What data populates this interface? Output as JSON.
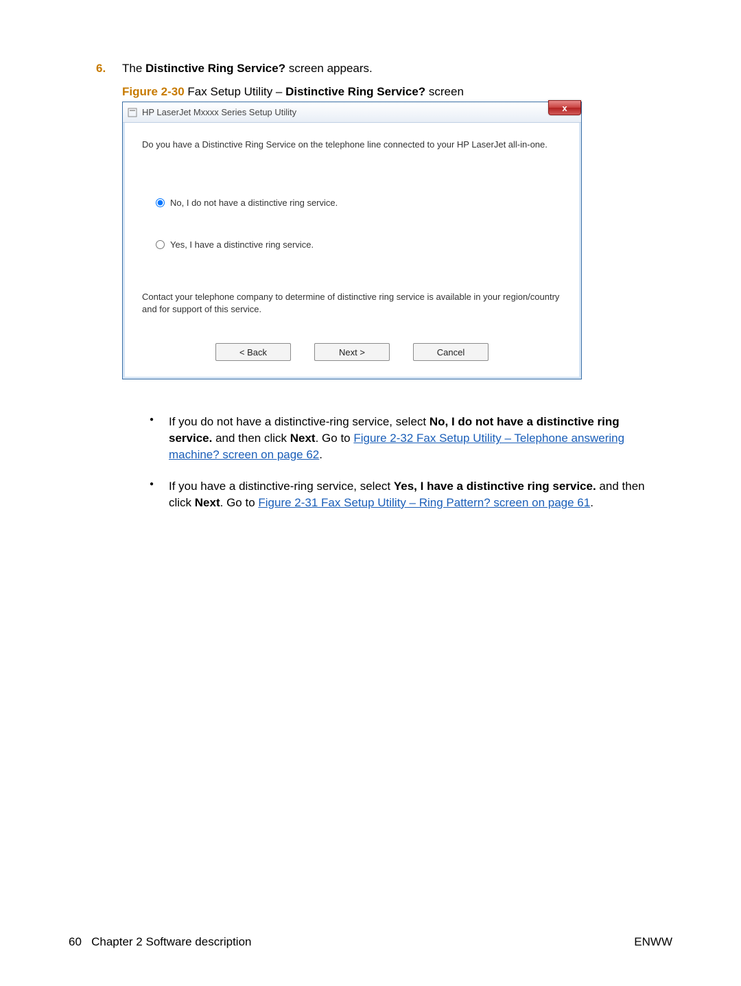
{
  "step": {
    "number": "6.",
    "text_before": "The ",
    "text_bold": "Distinctive Ring Service?",
    "text_after": " screen appears."
  },
  "figure_caption": {
    "label": "Figure 2-30",
    "text_before": "  Fax Setup Utility – ",
    "text_bold": "Distinctive Ring Service?",
    "text_after": " screen"
  },
  "dialog": {
    "title": "HP LaserJet Mxxxx Series Setup Utility",
    "close_label": "x",
    "question": "Do you have a Distinctive Ring Service on the telephone line connected to your HP LaserJet all-in-one.",
    "radio_no": "No, I do not have a distinctive ring service.",
    "radio_yes": "Yes, I have a distinctive ring service.",
    "note": "Contact your telephone company to determine of distinctive ring service is available in your region/country and for support of this service.",
    "btn_back": "< Back",
    "btn_next": "Next >",
    "btn_cancel": "Cancel"
  },
  "bullets": {
    "b1a": "If you do not have a distinctive-ring service, select ",
    "b1b": "No, I do not have a distinctive ring service.",
    "b1c": " and then click ",
    "b1d": "Next",
    "b1e": ". Go to ",
    "b1link": "Figure 2-32 Fax Setup Utility – Telephone answering machine? screen on page 62",
    "b1f": ".",
    "b2a": "If you have a distinctive-ring service, select ",
    "b2b": "Yes, I have a distinctive ring service.",
    "b2c": " and then click ",
    "b2d": "Next",
    "b2e": ". Go to ",
    "b2link": "Figure 2-31 Fax Setup Utility – Ring Pattern? screen on page 61",
    "b2f": "."
  },
  "footer": {
    "page": "60",
    "chapter": "Chapter 2   Software description",
    "right": "ENWW"
  }
}
